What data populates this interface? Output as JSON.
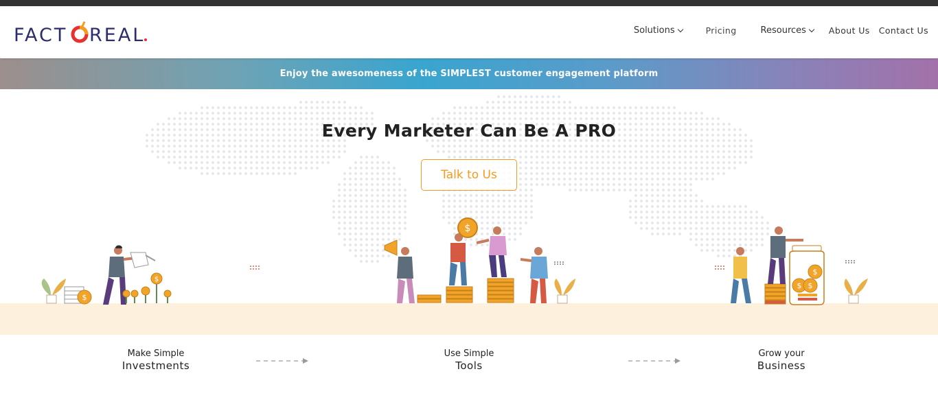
{
  "brand": {
    "name": "FACTOREAL",
    "accent": "#e8302f",
    "accent2": "#f49b1e",
    "primary": "#2b2d6e"
  },
  "nav": {
    "items": [
      {
        "label": "Solutions",
        "dropdown": true
      },
      {
        "label": "Pricing",
        "dropdown": false
      },
      {
        "label": "Resources",
        "dropdown": true
      },
      {
        "label": "About Us",
        "dropdown": false
      },
      {
        "label": "Contact Us",
        "dropdown": false
      }
    ]
  },
  "banner": {
    "text": "Enjoy the awesomeness of the SIMPLEST customer engagement platform"
  },
  "hero": {
    "headline_pre": "Every Marketer Can Be A ",
    "headline_emph": "PRO",
    "cta_label": "Talk to Us"
  },
  "steps": [
    {
      "line1": "Make Simple",
      "line2": "Investments"
    },
    {
      "line1": "Use Simple",
      "line2": "Tools"
    },
    {
      "line1": "Grow your",
      "line2": "Business"
    }
  ],
  "icons": [
    "chevron-down-icon",
    "arrow-right-icon",
    "world-map-illustration",
    "coin-icon"
  ]
}
